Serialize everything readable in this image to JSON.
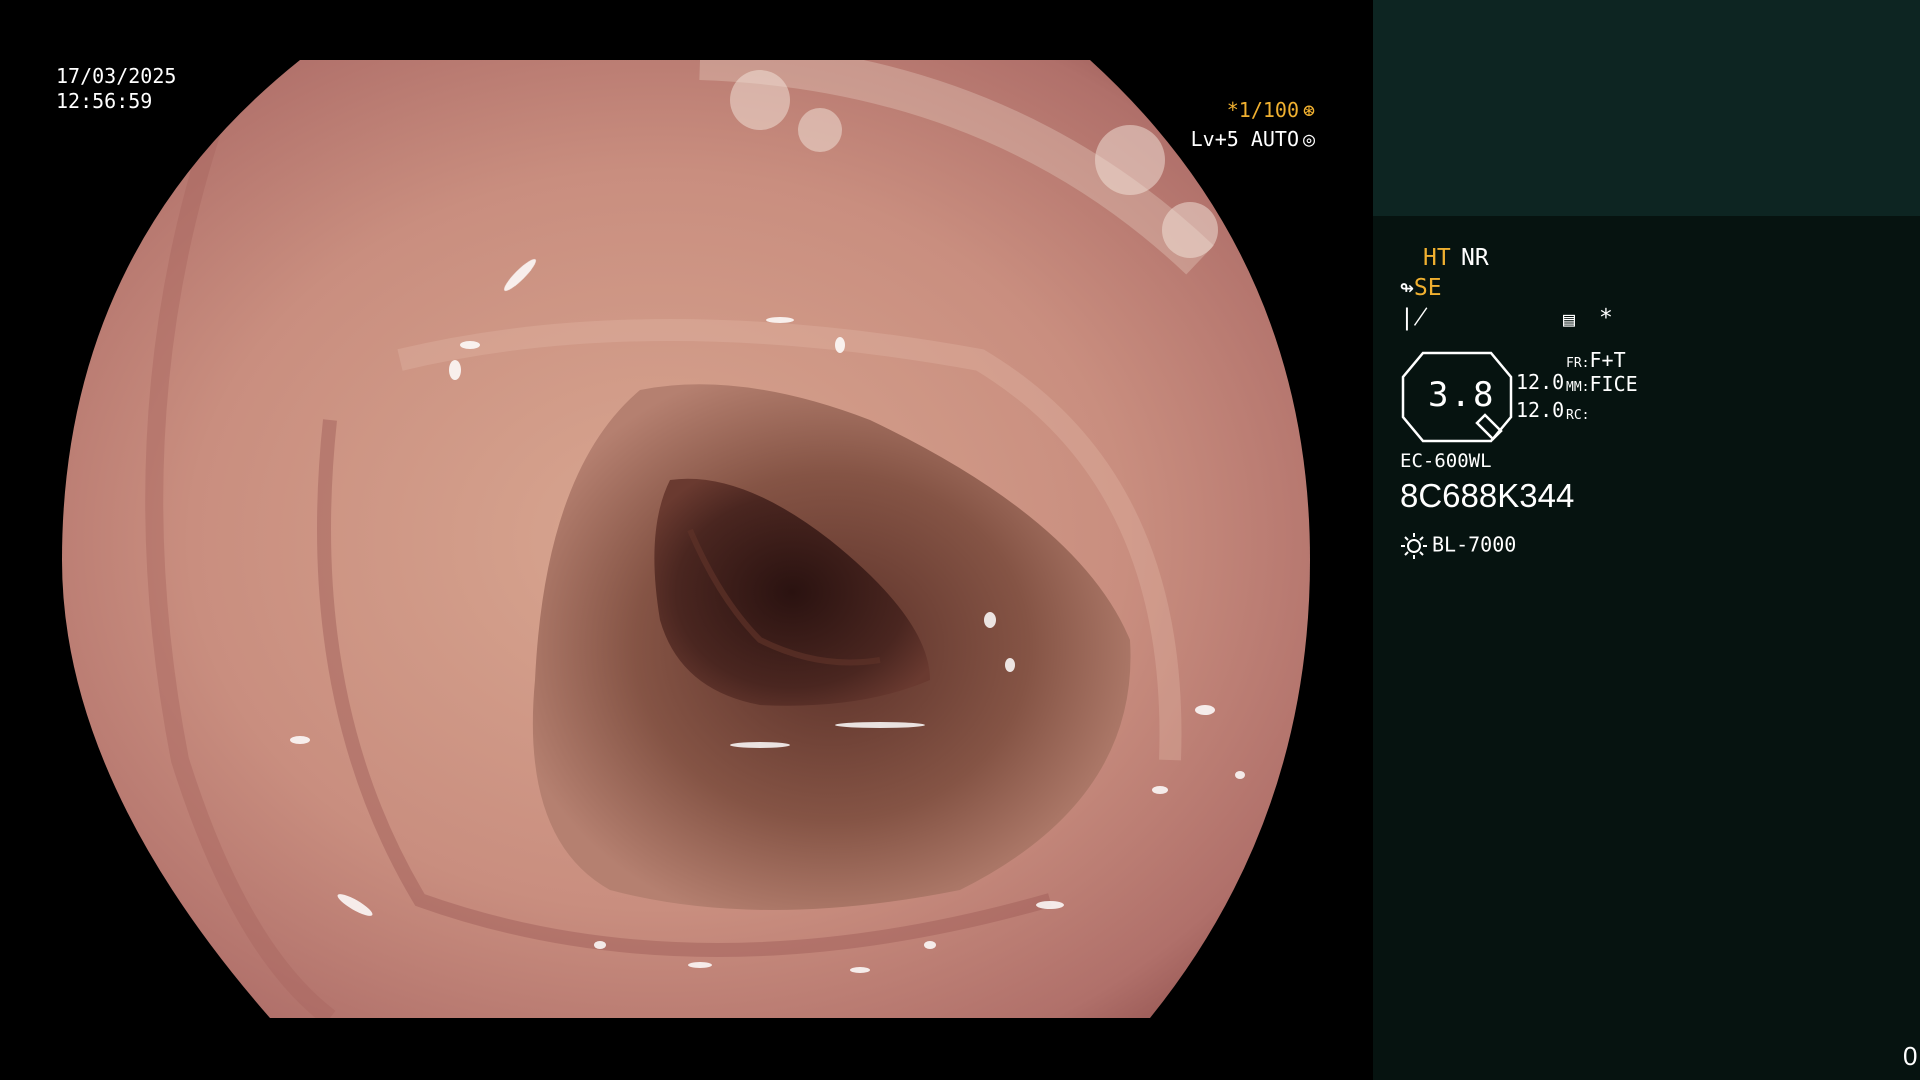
{
  "endoscope_view": {
    "date": "17/03/2025",
    "time": "12:56:59",
    "shutter": "*1/100",
    "level": "Lv+5 AUTO",
    "shutter_icon": "aperture-icon",
    "level_icon": "auto-iris-icon"
  },
  "side_panel": {
    "ht": "HT",
    "nr": "NR",
    "se": "SE",
    "se_icon": "structure-enhancement-icon",
    "tone_icon": "tone-curve-icon",
    "memo_icon": "memo-icon",
    "asterisk": "*",
    "zoom_value": "3.8",
    "value_top": "12.0",
    "value_bottom": "12.0",
    "fr_label": "FR:",
    "fr_value": "F+T",
    "mm_label": "MM:",
    "mm_value": "FICE",
    "rc_label": "RC:",
    "scope_model": "EC-600WL",
    "serial_number": "8C688K344",
    "lamp_model": "BL-7000",
    "lamp_icon": "light-source-icon",
    "counter": "0"
  },
  "colors": {
    "accent_orange": "#f0b030",
    "panel_header": "#0d2522",
    "panel_body": "#061310"
  }
}
